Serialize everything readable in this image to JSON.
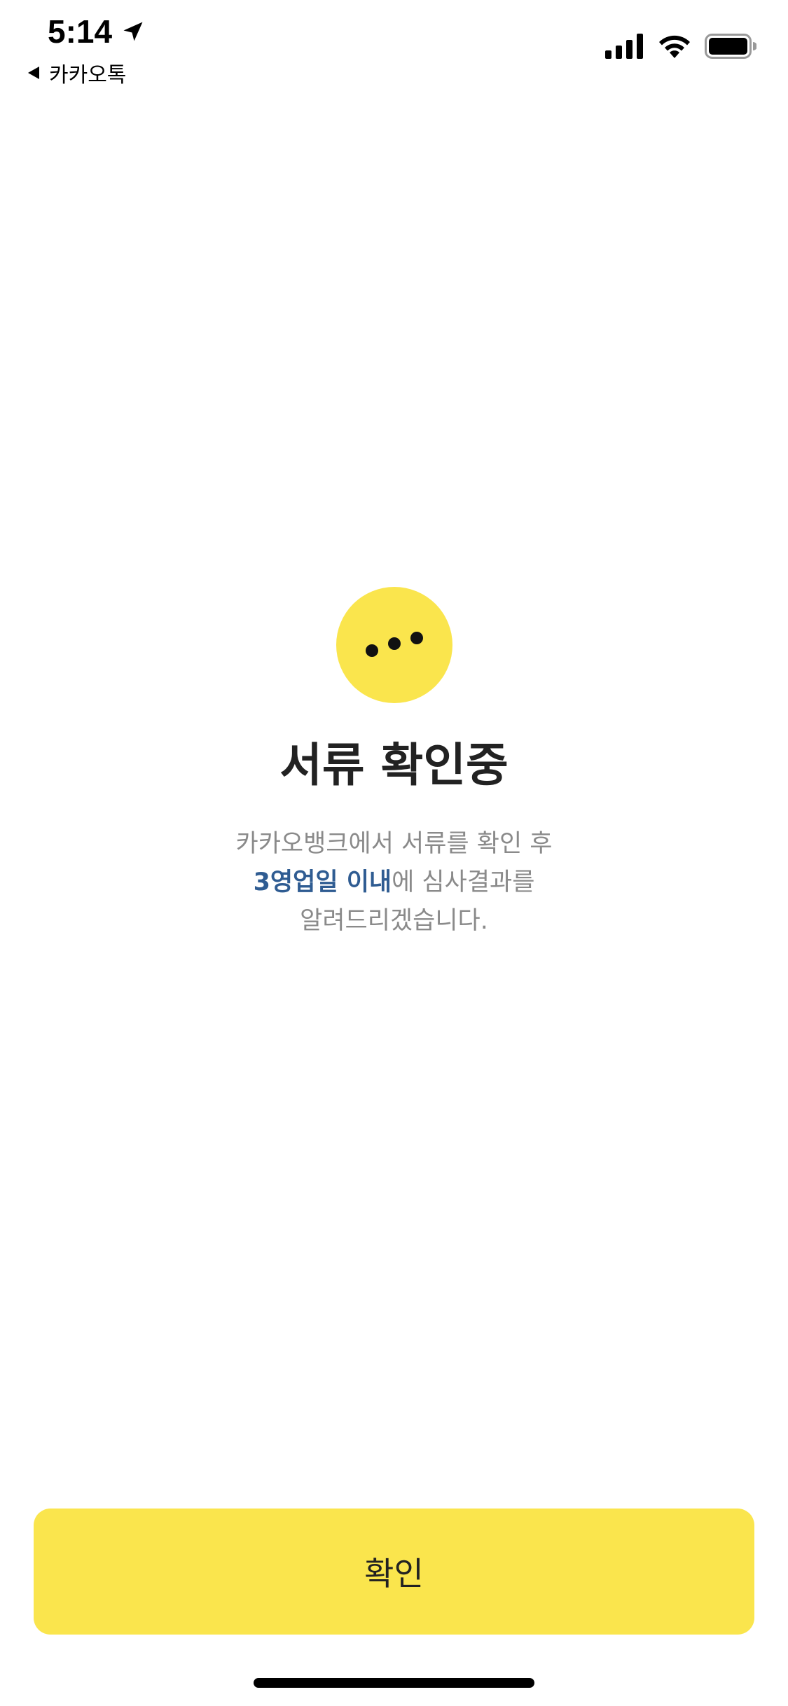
{
  "status_bar": {
    "time": "5:14",
    "back_app": "카카오톡",
    "icons": [
      "location-arrow-icon",
      "cellular-signal-icon",
      "wifi-icon",
      "battery-icon"
    ]
  },
  "main": {
    "status_icon": "ellipsis-icon",
    "title": "서류 확인중",
    "description": {
      "line1": "카카오뱅크에서 서류를 확인 후",
      "line2_highlight": "3영업일 이내",
      "line2_rest": "에 심사결과를",
      "line3": "알려드리겠습니다."
    }
  },
  "footer": {
    "confirm_label": "확인"
  },
  "colors": {
    "accent_yellow": "#fae54d",
    "highlight_blue": "#2f5c92",
    "title_text": "#222222",
    "body_text": "#8a8a8a"
  }
}
